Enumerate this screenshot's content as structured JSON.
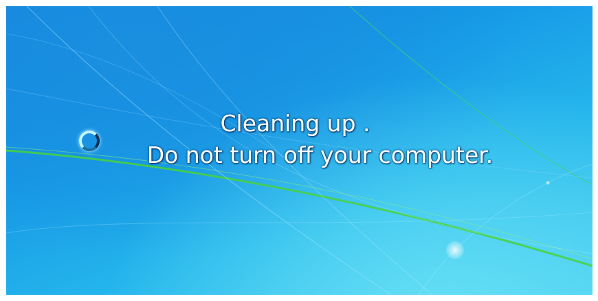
{
  "status": {
    "line1": "Cleaning up .",
    "line2": "Do not turn off your computer."
  },
  "icons": {
    "spinner": "busy-spinner-icon"
  },
  "colors": {
    "background_top": "#137fdc",
    "background_bottom": "#49cdf0",
    "text": "#ffffff"
  }
}
